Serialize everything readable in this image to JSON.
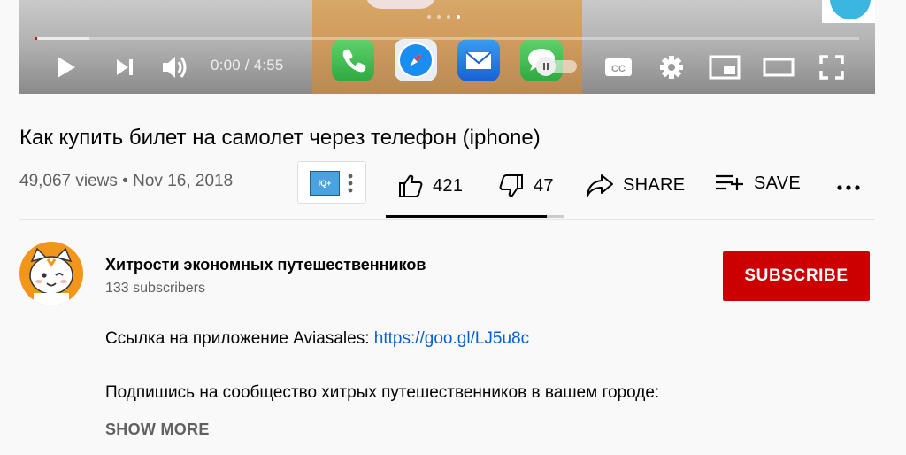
{
  "player": {
    "time_display": "0:00 / 4:55",
    "progress_played": 0.002,
    "progress_loaded": 0.065,
    "carousel_dots": 4,
    "carousel_active": 3,
    "icons": [
      "play-icon",
      "next-icon",
      "volume-icon",
      "autoplay-toggle",
      "captions-icon",
      "settings-icon",
      "miniplayer-icon",
      "theater-icon",
      "fullscreen-icon"
    ],
    "captions_label": "CC"
  },
  "video": {
    "title": "Как купить билет на самолет через телефон (iphone)",
    "views": "49,067 views",
    "separator": "•",
    "date": "Nov 16, 2018",
    "extension_logo": "IQ+"
  },
  "actions": {
    "likes": "421",
    "dislikes": "47",
    "share": "SHARE",
    "save": "SAVE",
    "like_ratio": 0.9
  },
  "channel": {
    "name": "Хитрости экономных путешественников",
    "subscribers": "133 subscribers",
    "subscribe": "SUBSCRIBE"
  },
  "description": {
    "line1_text": "Ссылка на приложение Aviasales: ",
    "line1_link": "https://goo.gl/LJ5u8c",
    "line2_text": "Подпишись на сообщество хитрых путешественников в вашем городе:",
    "show_more": "SHOW MORE"
  },
  "colors": {
    "subscribe_bg": "#cc0000",
    "progress_played": "#ff0000",
    "link": "#065fd4",
    "avatar_bg": "#f2951b"
  }
}
